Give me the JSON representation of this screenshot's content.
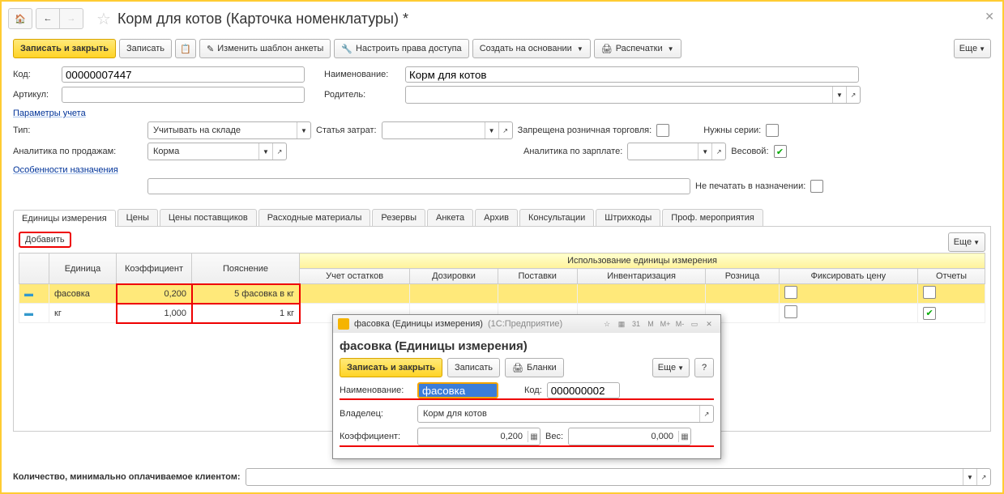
{
  "title": "Корм для котов (Карточка номенклатуры) *",
  "toolbar": {
    "save_close": "Записать и закрыть",
    "save": "Записать",
    "edit_template": "Изменить шаблон анкеты",
    "rights": "Настроить права доступа",
    "create_base": "Создать на основании",
    "prints": "Распечатки",
    "more": "Еще"
  },
  "fields": {
    "code_label": "Код:",
    "code": "00000007447",
    "article_label": "Артикул:",
    "article": "",
    "name_label": "Наименование:",
    "name": "Корм для котов",
    "parent_label": "Родитель:",
    "parent": ""
  },
  "section_accounting": "Параметры учета",
  "params": {
    "type_label": "Тип:",
    "type": "Учитывать на складе",
    "cost_label": "Статья затрат:",
    "cost": "",
    "retail_label": "Запрещена розничная торговля:",
    "series_label": "Нужны серии:",
    "sales_label": "Аналитика по продажам:",
    "sales": "Корма",
    "salary_label": "Аналитика по зарплате:",
    "salary": "",
    "weight_label": "Весовой:"
  },
  "section_purpose": "Особенности назначения",
  "purpose": {
    "noprint_label": "Не печатать в назначении:"
  },
  "tabs": [
    "Единицы измерения",
    "Цены",
    "Цены поставщиков",
    "Расходные материалы",
    "Резервы",
    "Анкета",
    "Архив",
    "Консультации",
    "Штрихкоды",
    "Проф. мероприятия"
  ],
  "grid": {
    "add": "Добавить",
    "more": "Еще",
    "cols": {
      "unit": "Единица",
      "coef": "Коэффициент",
      "expl": "Пояснение",
      "usage": "Использование единицы измерения",
      "stock": "Учет остатков",
      "dose": "Дозировки",
      "supply": "Поставки",
      "inv": "Инвентаризация",
      "retail": "Розница",
      "fix": "Фиксировать цену",
      "reports": "Отчеты"
    },
    "rows": [
      {
        "unit": "фасовка",
        "coef": "0,200",
        "expl": "5 фасовка в кг",
        "fix": false,
        "reports": false
      },
      {
        "unit": "кг",
        "coef": "1,000",
        "expl": "1 кг",
        "fix": false,
        "reports": true
      }
    ]
  },
  "bottom": {
    "qty_label": "Количество, минимально оплачиваемое клиентом:"
  },
  "popup": {
    "wintitle": "фасовка (Единицы измерения)",
    "winapp": "(1С:Предприятие)",
    "header": "фасовка (Единицы измерения)",
    "save_close": "Записать и закрыть",
    "save": "Записать",
    "blanks": "Бланки",
    "more": "Еще",
    "name_label": "Наименование:",
    "name": "фасовка",
    "code_label": "Код:",
    "code": "000000002",
    "owner_label": "Владелец:",
    "owner": "Корм для котов",
    "coef_label": "Коэффициент:",
    "coef": "0,200",
    "weight_label": "Вес:",
    "weight": "0,000"
  }
}
